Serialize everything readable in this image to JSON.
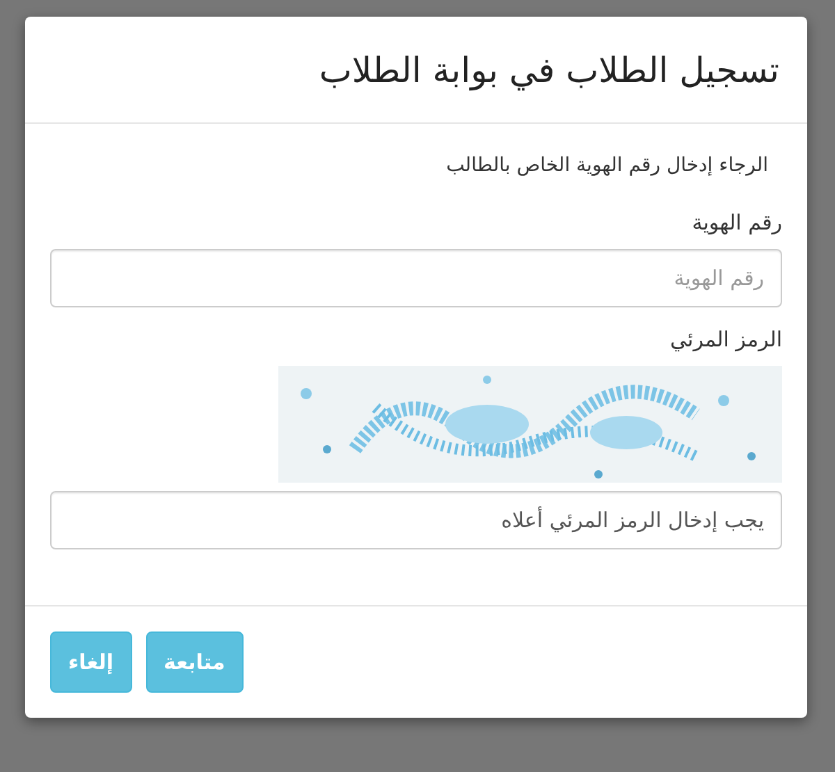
{
  "dialog": {
    "title": "تسجيل الطلاب في بوابة الطلاب",
    "instruction": "الرجاء إدخال رقم الهوية الخاص بالطالب",
    "fields": [
      {
        "kind": "text",
        "label": "رقم الهوية",
        "placeholder": "رقم الهوية"
      },
      {
        "kind": "captcha",
        "label": "الرمز المرئي",
        "value": "يجب إدخال الرمز المرئي أعلاه"
      }
    ],
    "buttons": [
      "متابعة",
      "إلغاء"
    ]
  }
}
